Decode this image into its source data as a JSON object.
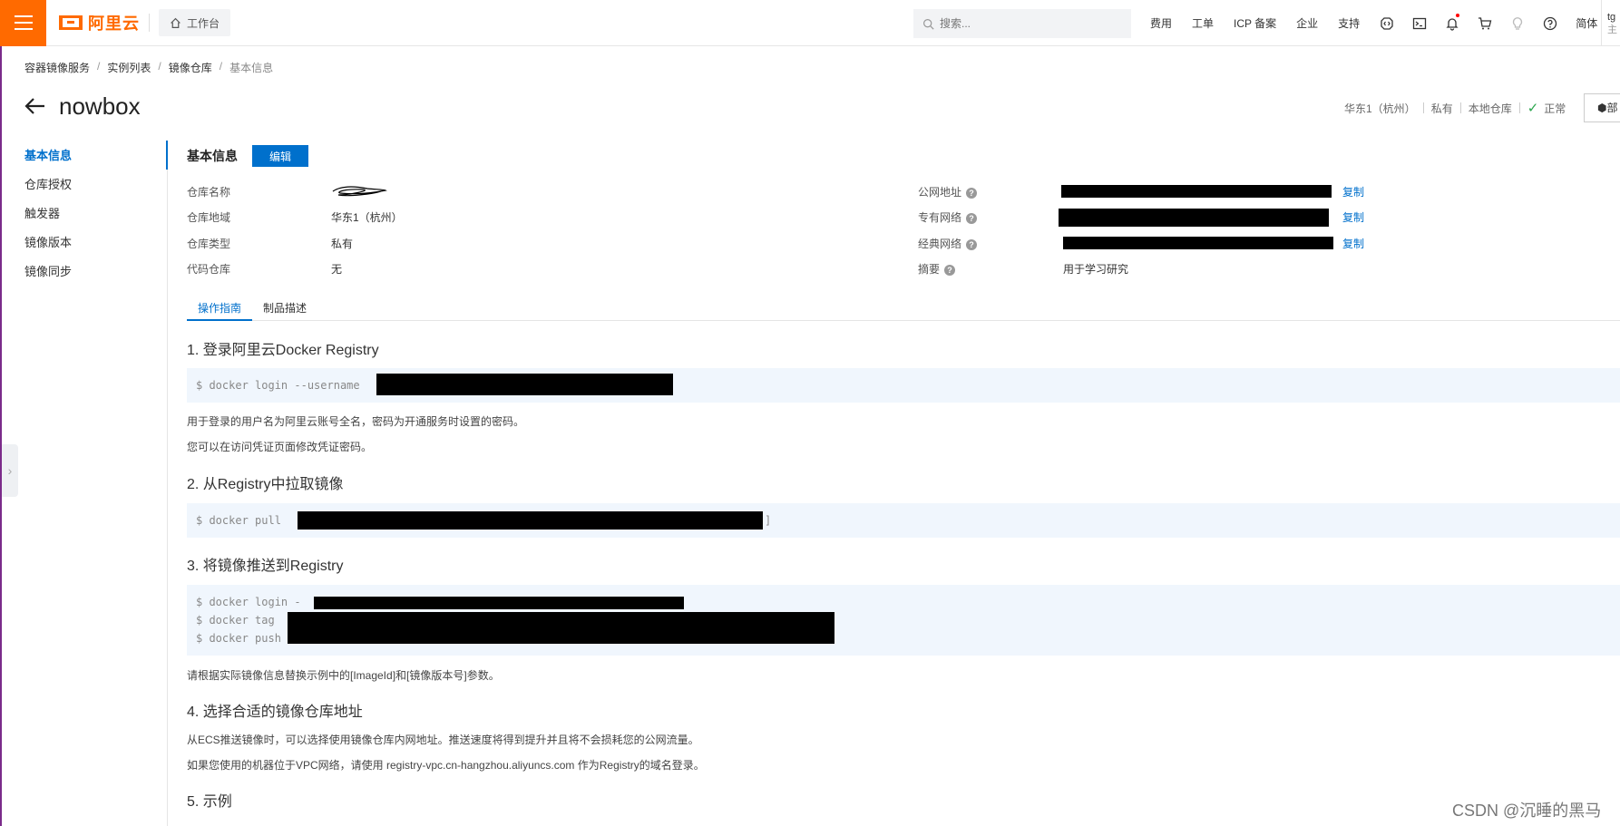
{
  "topbar": {
    "brand": "阿里云",
    "workbench": "工作台",
    "search_placeholder": "搜索...",
    "links": [
      "费用",
      "工单",
      "ICP 备案",
      "企业",
      "支持"
    ],
    "lang": "简体",
    "user_line1": "tg",
    "user_line2": "主"
  },
  "breadcrumb": [
    "容器镜像服务",
    "实例列表",
    "镜像仓库",
    "基本信息"
  ],
  "page": {
    "title": "nowbox",
    "region": "华东1（杭州）",
    "visibility": "私有",
    "repo_type": "本地仓库",
    "status": "正常",
    "deploy_label": "部"
  },
  "sidebar": {
    "items": [
      "基本信息",
      "仓库授权",
      "触发器",
      "镜像版本",
      "镜像同步"
    ]
  },
  "basic_info": {
    "title": "基本信息",
    "edit": "编辑",
    "left": [
      {
        "label": "仓库名称",
        "value": ""
      },
      {
        "label": "仓库地域",
        "value": "华东1（杭州）"
      },
      {
        "label": "仓库类型",
        "value": "私有"
      },
      {
        "label": "代码仓库",
        "value": "无"
      }
    ],
    "right": [
      {
        "label": "公网地址",
        "value": "",
        "copy": "复制"
      },
      {
        "label": "专有网络",
        "value": "",
        "copy": "复制"
      },
      {
        "label": "经典网络",
        "value": "",
        "copy": "复制"
      },
      {
        "label": "摘要",
        "value": "用于学习研究",
        "copy": ""
      }
    ]
  },
  "tabs": [
    "操作指南",
    "制品描述"
  ],
  "guide": {
    "step1_title": "1. 登录阿里云Docker Registry",
    "step1_code": "$ docker login --username",
    "step1_note1": "用于登录的用户名为阿里云账号全名，密码为开通服务时设置的密码。",
    "step1_note2": "您可以在访问凭证页面修改凭证密码。",
    "step2_title": "2. 从Registry中拉取镜像",
    "step2_code": "$ docker pull",
    "step2_tail": "]",
    "step3_title": "3. 将镜像推送到Registry",
    "step3_code1": "$ docker login -",
    "step3_code2": "$ docker tag",
    "step3_code3": "$ docker push",
    "step3_note": "请根据实际镜像信息替换示例中的[ImageId]和[镜像版本号]参数。",
    "step4_title": "4. 选择合适的镜像仓库地址",
    "step4_note1": "从ECS推送镜像时，可以选择使用镜像仓库内网地址。推送速度将得到提升并且将不会损耗您的公网流量。",
    "step4_note2": "如果您使用的机器位于VPC网络，请使用 registry-vpc.cn-hangzhou.aliyuncs.com 作为Registry的域名登录。",
    "step5_title": "5. 示例"
  },
  "watermark": "CSDN @沉睡的黑马",
  "colors": {
    "brand": "#ff6a00",
    "primary": "#0070cc",
    "ok": "#2aa64d",
    "code_bg": "#f0f6fd"
  }
}
